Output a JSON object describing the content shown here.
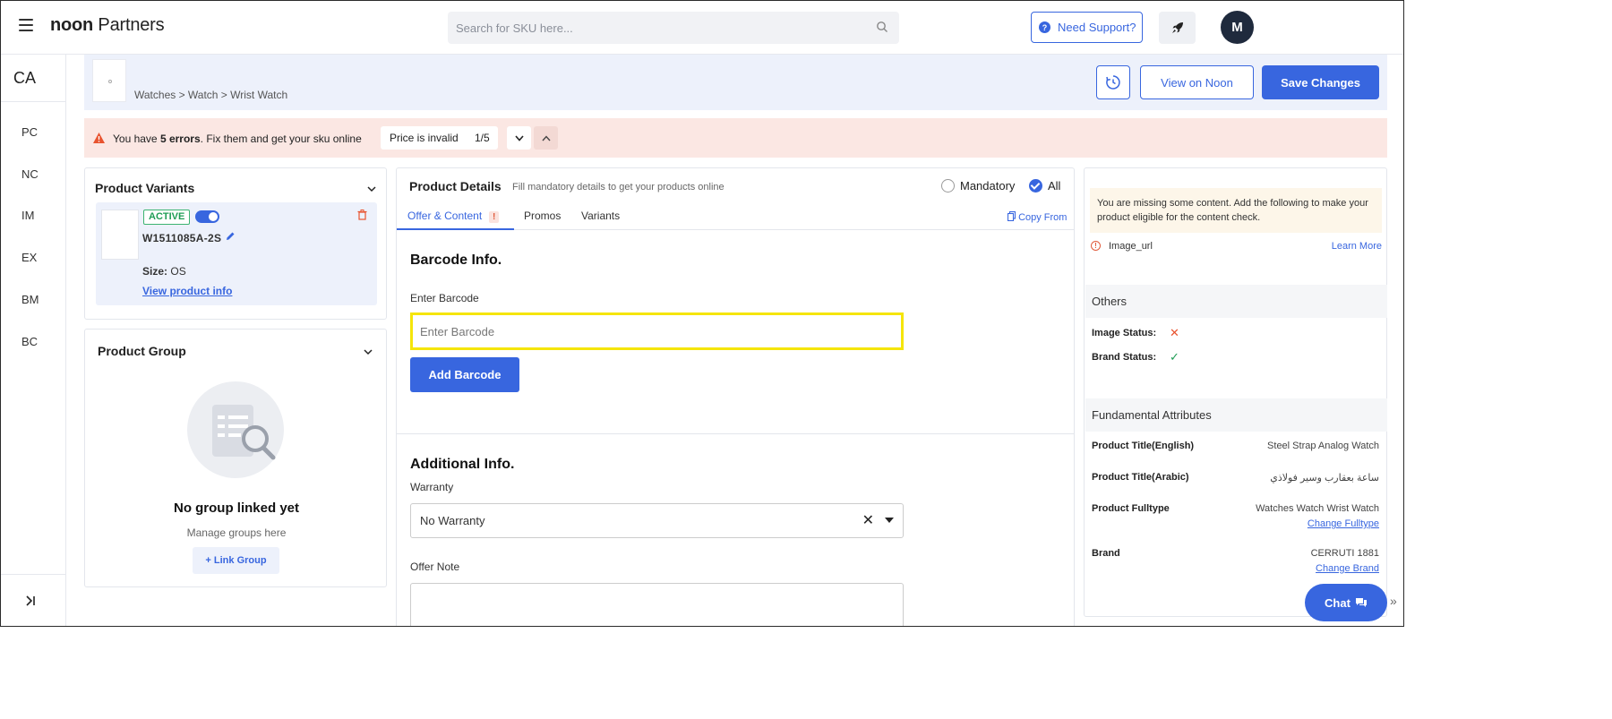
{
  "topbar": {
    "brand_bold": "noon",
    "brand_rest": " Partners",
    "search_placeholder": "Search for SKU here...",
    "support_label": "Need Support?",
    "avatar_initial": "M"
  },
  "rail": {
    "top": "CA",
    "items": [
      "PC",
      "NC",
      "IM",
      "EX",
      "BM",
      "BC"
    ]
  },
  "header": {
    "breadcrumb": "Watches > Watch > Wrist Watch",
    "view_label": "View on Noon",
    "save_label": "Save Changes"
  },
  "error_bar": {
    "prefix": "You have ",
    "count_text": "5 errors",
    "suffix": ". Fix them and get your sku online",
    "nav_label": "Price is invalid",
    "nav_count": "1/5"
  },
  "variants": {
    "title": "Product Variants",
    "status": "ACTIVE",
    "sku": "W1511085A-2S",
    "size_label": "Size:",
    "size_value": "OS",
    "view_info": "View product info"
  },
  "group": {
    "title": "Product Group",
    "empty_title": "No group linked yet",
    "empty_sub": "Manage groups here",
    "link_label": "+ Link Group"
  },
  "details": {
    "title": "Product Details",
    "subtitle": "Fill mandatory details to get your products online",
    "radio_mandatory": "Mandatory",
    "radio_all": "All",
    "tabs": [
      "Offer & Content",
      "Promos",
      "Variants"
    ],
    "tab_alert": "!",
    "copy_from": "Copy From",
    "barcode_heading": "Barcode Info.",
    "barcode_label": "Enter Barcode",
    "barcode_placeholder": "Enter Barcode",
    "add_barcode": "Add Barcode",
    "additional_heading": "Additional Info.",
    "warranty_label": "Warranty",
    "warranty_value": "No Warranty",
    "offer_note_label": "Offer Note"
  },
  "right": {
    "missing_text": "You are missing some content. Add the following to make your product eligible for the content check.",
    "missing_item": "Image_url",
    "learn_more": "Learn More",
    "others_heading": "Others",
    "image_status_label": "Image Status:",
    "brand_status_label": "Brand Status:",
    "fundamental_heading": "Fundamental Attributes",
    "attrs": [
      {
        "label": "Product Title(English)",
        "value": "Steel Strap Analog Watch"
      },
      {
        "label": "Product Title(Arabic)",
        "value": "ساعة بعقارب وسير فولاذي"
      },
      {
        "label": "Product Fulltype",
        "value": "Watches Watch Wrist Watch",
        "link": "Change Fulltype"
      },
      {
        "label": "Brand",
        "value": "CERRUTI 1881",
        "link": "Change Brand"
      }
    ]
  },
  "chat": {
    "label": "Chat"
  },
  "colors": {
    "primary": "#3866df",
    "error_bg": "#fbe7e3",
    "header_bg": "#edf1fb",
    "highlight": "#f5e50a"
  },
  "icons": [
    "menu-icon",
    "search-icon",
    "help-icon",
    "rocket-icon",
    "history-icon",
    "warning-icon",
    "chevron-down-icon",
    "chevron-up-icon",
    "edit-icon",
    "trash-icon",
    "copy-icon",
    "close-icon",
    "check-icon",
    "chat-icon",
    "collapse-icon"
  ]
}
